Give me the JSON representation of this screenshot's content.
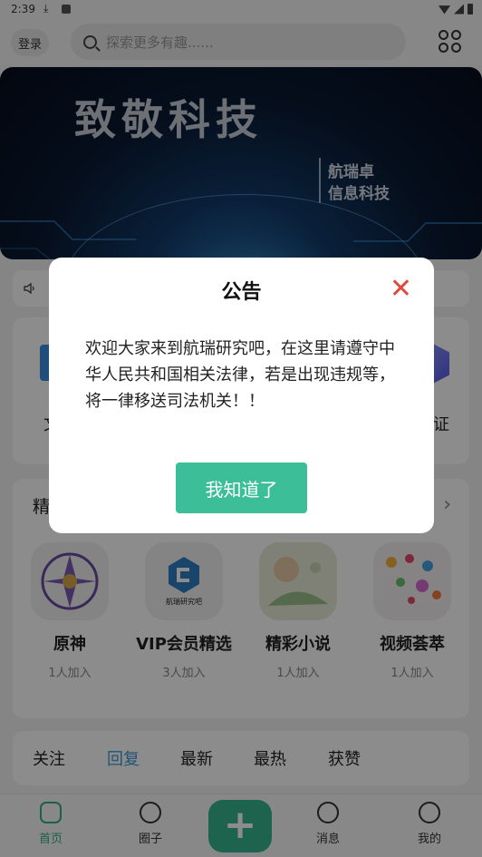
{
  "status_bar": {
    "time": "2:39"
  },
  "header": {
    "login_label": "登录",
    "search_placeholder": "探索更多有趣......"
  },
  "banner": {
    "title": "致敬科技",
    "subtitle_line1": "航瑞卓",
    "subtitle_line2": "信息科技"
  },
  "quick_links": {
    "left_label": "文",
    "right_label": "认证"
  },
  "featured": {
    "title": "精"
  },
  "circles": [
    {
      "name": "原神",
      "members": "1人加入",
      "icon": "genshin-art-icon"
    },
    {
      "name": "VIP会员精选",
      "members": "3人加入",
      "icon": "hangrui-logo-icon",
      "logo_text": "航瑞研究吧"
    },
    {
      "name": "精彩小说",
      "members": "1人加入",
      "icon": "novel-art-icon"
    },
    {
      "name": "视频荟萃",
      "members": "1人加入",
      "icon": "video-art-icon"
    }
  ],
  "feed_tabs": [
    {
      "label": "关注",
      "active": false
    },
    {
      "label": "回复",
      "active": true
    },
    {
      "label": "最新",
      "active": false
    },
    {
      "label": "最热",
      "active": false
    },
    {
      "label": "获赞",
      "active": false
    }
  ],
  "bottom_nav": {
    "home": "首页",
    "circles": "圈子",
    "add": "+",
    "messages": "消息",
    "mine": "我的"
  },
  "dialog": {
    "title": "公告",
    "close": "✕",
    "message": "欢迎大家来到航瑞研究吧，在这里请遵守中华人民共和国相关法律，若是出现违规等，将一律移送司法机关！！",
    "confirm_label": "我知道了"
  },
  "colors": {
    "accent_green": "#3cbf98",
    "active_tab_blue": "#3a9bd8",
    "close_red": "#e04a3a"
  }
}
